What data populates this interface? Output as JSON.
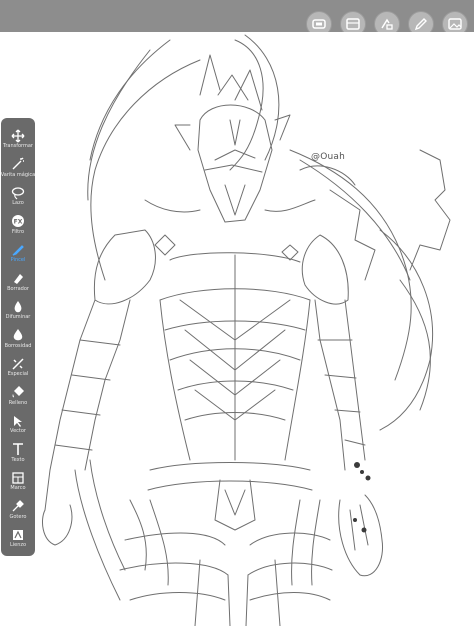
{
  "app": {
    "top_tools": [
      {
        "name": "gallery-icon"
      },
      {
        "name": "layers-actions-icon"
      },
      {
        "name": "adjust-icon"
      },
      {
        "name": "pencil-edit-icon"
      },
      {
        "name": "image-icon"
      }
    ]
  },
  "canvas": {
    "signature": "@Ouah"
  },
  "toolbar": {
    "tools": [
      {
        "label": "Transformar",
        "icon": "move-icon"
      },
      {
        "label": "Varita mágica",
        "icon": "magic-wand-icon"
      },
      {
        "label": "Lazo",
        "icon": "lasso-icon"
      },
      {
        "label": "Filtro",
        "icon": "fx-icon"
      },
      {
        "label": "Pincel",
        "icon": "brush-icon",
        "active": true
      },
      {
        "label": "Borrador",
        "icon": "eraser-icon"
      },
      {
        "label": "Difuminar",
        "icon": "smudge-icon"
      },
      {
        "label": "Borrosidad",
        "icon": "blur-icon"
      },
      {
        "label": "Especial",
        "icon": "special-icon"
      },
      {
        "label": "Relleno",
        "icon": "fill-icon"
      },
      {
        "label": "Vector",
        "icon": "vector-icon"
      },
      {
        "label": "Texto",
        "icon": "text-icon"
      },
      {
        "label": "Marco",
        "icon": "frame-icon"
      },
      {
        "label": "Gotero",
        "icon": "eyedropper-icon"
      },
      {
        "label": "Lienzo",
        "icon": "canvas-icon"
      }
    ],
    "accent_color": "#4aa8ff"
  }
}
